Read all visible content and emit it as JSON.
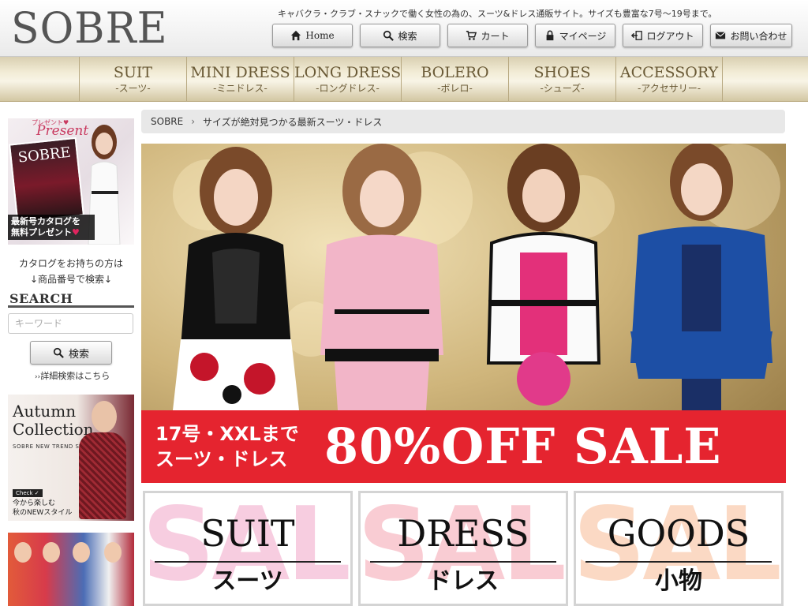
{
  "header": {
    "logo": "SOBRE",
    "tagline": "キャバクラ・クラブ・スナックで働く女性の為の、スーツ&ドレス通販サイト。サイズも豊富な7号〜19号まで。",
    "buttons": [
      {
        "label": "Home",
        "icon": "home-icon"
      },
      {
        "label": "検索",
        "icon": "search-icon"
      },
      {
        "label": "カート",
        "icon": "cart-icon"
      },
      {
        "label": "マイページ",
        "icon": "lock-icon"
      },
      {
        "label": "ログアウト",
        "icon": "logout-icon"
      },
      {
        "label": "お問い合わせ",
        "icon": "mail-icon"
      }
    ]
  },
  "categories": [
    {
      "en": "SUIT",
      "ja": "-スーツ-"
    },
    {
      "en": "MINI DRESS",
      "ja": "-ミニドレス-"
    },
    {
      "en": "LONG DRESS",
      "ja": "-ロングドレス-"
    },
    {
      "en": "BOLERO",
      "ja": "-ボレロ-"
    },
    {
      "en": "SHOES",
      "ja": "-シューズ-"
    },
    {
      "en": "ACCESSORY",
      "ja": "-アクセサリー-"
    }
  ],
  "sidebar": {
    "present_banner": {
      "small": "プレゼント♥",
      "title": "Present",
      "cover": "SOBRE",
      "caption_line1": "最新号カタログを",
      "caption_line2": "無料プレゼント"
    },
    "catalog_note_line1": "カタログをお持ちの方は",
    "catalog_note_line2": "↓商品番号で検索↓",
    "search_heading": "SEARCH",
    "keyword_placeholder": "キーワード",
    "search_button": "検索",
    "advanced_link": "詳細検索はこちら",
    "autumn_banner": {
      "title_line1": "Autumn",
      "title_line2": "Collection",
      "sub": "SOBRE NEW TREND STYLE",
      "check": "Check ✓",
      "copy_line1": "今から楽しむ",
      "copy_line2": "秋のNEWスタイル"
    }
  },
  "breadcrumb": {
    "home": "SOBRE",
    "current": "サイズが絶対見つかる最新スーツ・ドレス"
  },
  "hero": {
    "left_line1": "17号・XXLまで",
    "left_line2": "スーツ・ドレス",
    "headline": "80%OFF SALE"
  },
  "tiles": [
    {
      "bg": "SALE",
      "en": "SUIT",
      "ja": "スーツ",
      "bg_color": "#f7cde0"
    },
    {
      "bg": "SALE",
      "en": "DRESS",
      "ja": "ドレス",
      "bg_color": "#f9ccd3"
    },
    {
      "bg": "SALE",
      "en": "GOODS",
      "ja": "小物",
      "bg_color": "#fbd9c4"
    }
  ],
  "colors": {
    "sale_red": "#e5242f",
    "nav_gold": "#d9cfb1",
    "nav_text": "#6a5a36"
  }
}
